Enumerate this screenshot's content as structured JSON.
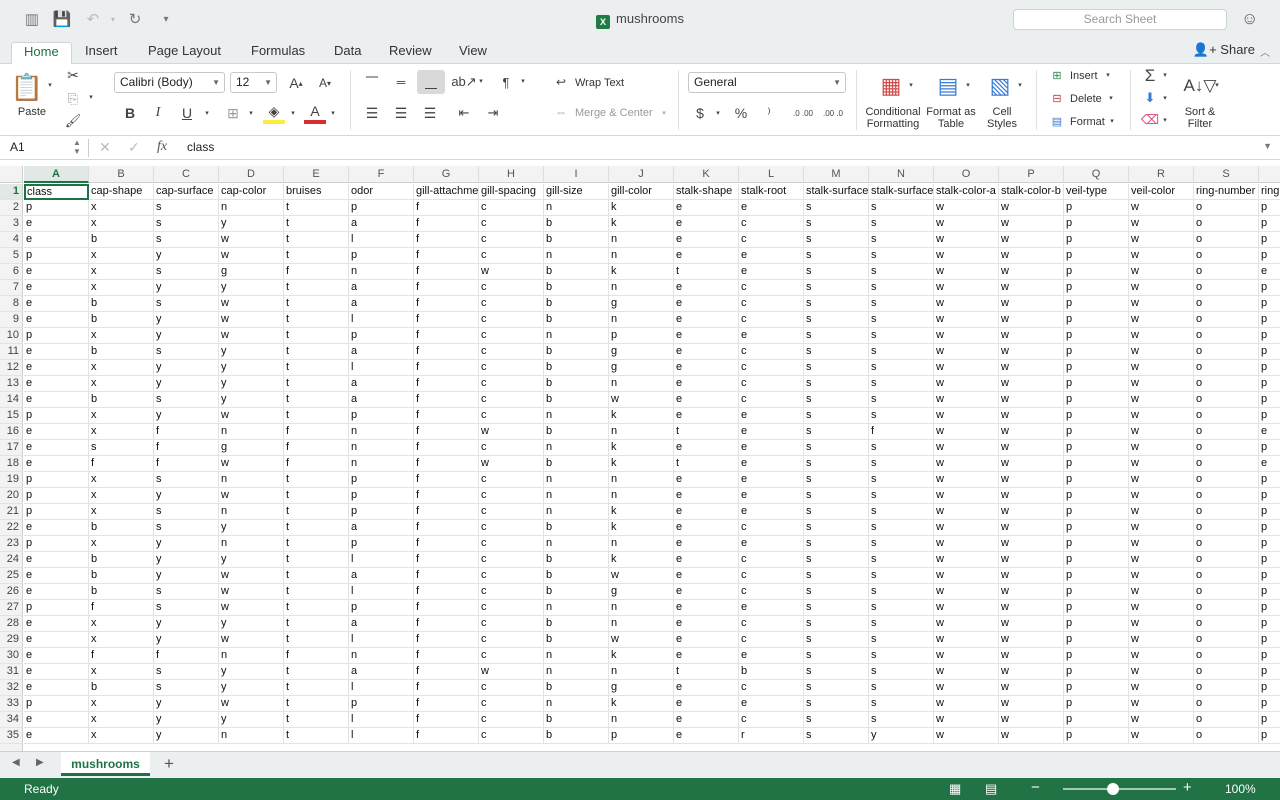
{
  "app": {
    "document_title": "mushrooms",
    "search_placeholder": "Search Sheet"
  },
  "tabs": [
    {
      "label": "Home",
      "active": true
    },
    {
      "label": "Insert"
    },
    {
      "label": "Page Layout"
    },
    {
      "label": "Formulas"
    },
    {
      "label": "Data"
    },
    {
      "label": "Review"
    },
    {
      "label": "View"
    }
  ],
  "share_label": "Share",
  "ribbon": {
    "paste_label": "Paste",
    "font_name": "Calibri (Body)",
    "font_size": "12",
    "wrap_text_label": "Wrap Text",
    "merge_center_label": "Merge & Center",
    "number_format": "General",
    "conditional_formatting_label": "Conditional Formatting",
    "format_as_table_label": "Format as Table",
    "cell_styles_label": "Cell Styles",
    "insert_label": "Insert",
    "delete_label": "Delete",
    "format_label": "Format",
    "sort_filter_label": "Sort & Filter",
    "bold_glyph": "B",
    "italic_glyph": "I",
    "underline_glyph": "U",
    "currency_glyph": "$",
    "percent_glyph": "%",
    "increase_decimal_glyph": ".0 .00",
    "decrease_decimal_glyph": ".00 .0"
  },
  "formula_bar": {
    "name_box": "A1",
    "fx": "fx",
    "content": "class"
  },
  "grid": {
    "columns": [
      "A",
      "B",
      "C",
      "D",
      "E",
      "F",
      "G",
      "H",
      "I",
      "J",
      "K",
      "L",
      "M",
      "N",
      "O",
      "P",
      "Q",
      "R",
      "S"
    ],
    "rows": [
      {
        "n": "1",
        "cells": [
          "class",
          "cap-shape",
          "cap-surface",
          "cap-color",
          "bruises",
          "odor",
          "gill-attachme",
          "gill-spacing",
          "gill-size",
          "gill-color",
          "stalk-shape",
          "stalk-root",
          "stalk-surface",
          "stalk-surface",
          "stalk-color-a",
          "stalk-color-b",
          "veil-type",
          "veil-color",
          "ring-number",
          "ring"
        ]
      },
      {
        "n": "2",
        "cells": [
          "p",
          "x",
          "s",
          "n",
          "t",
          "p",
          "f",
          "c",
          "n",
          "k",
          "e",
          "e",
          "s",
          "s",
          "w",
          "w",
          "p",
          "w",
          "o",
          "p"
        ]
      },
      {
        "n": "3",
        "cells": [
          "e",
          "x",
          "s",
          "y",
          "t",
          "a",
          "f",
          "c",
          "b",
          "k",
          "e",
          "c",
          "s",
          "s",
          "w",
          "w",
          "p",
          "w",
          "o",
          "p"
        ]
      },
      {
        "n": "4",
        "cells": [
          "e",
          "b",
          "s",
          "w",
          "t",
          "l",
          "f",
          "c",
          "b",
          "n",
          "e",
          "c",
          "s",
          "s",
          "w",
          "w",
          "p",
          "w",
          "o",
          "p"
        ]
      },
      {
        "n": "5",
        "cells": [
          "p",
          "x",
          "y",
          "w",
          "t",
          "p",
          "f",
          "c",
          "n",
          "n",
          "e",
          "e",
          "s",
          "s",
          "w",
          "w",
          "p",
          "w",
          "o",
          "p"
        ]
      },
      {
        "n": "6",
        "cells": [
          "e",
          "x",
          "s",
          "g",
          "f",
          "n",
          "f",
          "w",
          "b",
          "k",
          "t",
          "e",
          "s",
          "s",
          "w",
          "w",
          "p",
          "w",
          "o",
          "e"
        ]
      },
      {
        "n": "7",
        "cells": [
          "e",
          "x",
          "y",
          "y",
          "t",
          "a",
          "f",
          "c",
          "b",
          "n",
          "e",
          "c",
          "s",
          "s",
          "w",
          "w",
          "p",
          "w",
          "o",
          "p"
        ]
      },
      {
        "n": "8",
        "cells": [
          "e",
          "b",
          "s",
          "w",
          "t",
          "a",
          "f",
          "c",
          "b",
          "g",
          "e",
          "c",
          "s",
          "s",
          "w",
          "w",
          "p",
          "w",
          "o",
          "p"
        ]
      },
      {
        "n": "9",
        "cells": [
          "e",
          "b",
          "y",
          "w",
          "t",
          "l",
          "f",
          "c",
          "b",
          "n",
          "e",
          "c",
          "s",
          "s",
          "w",
          "w",
          "p",
          "w",
          "o",
          "p"
        ]
      },
      {
        "n": "10",
        "cells": [
          "p",
          "x",
          "y",
          "w",
          "t",
          "p",
          "f",
          "c",
          "n",
          "p",
          "e",
          "e",
          "s",
          "s",
          "w",
          "w",
          "p",
          "w",
          "o",
          "p"
        ]
      },
      {
        "n": "11",
        "cells": [
          "e",
          "b",
          "s",
          "y",
          "t",
          "a",
          "f",
          "c",
          "b",
          "g",
          "e",
          "c",
          "s",
          "s",
          "w",
          "w",
          "p",
          "w",
          "o",
          "p"
        ]
      },
      {
        "n": "12",
        "cells": [
          "e",
          "x",
          "y",
          "y",
          "t",
          "l",
          "f",
          "c",
          "b",
          "g",
          "e",
          "c",
          "s",
          "s",
          "w",
          "w",
          "p",
          "w",
          "o",
          "p"
        ]
      },
      {
        "n": "13",
        "cells": [
          "e",
          "x",
          "y",
          "y",
          "t",
          "a",
          "f",
          "c",
          "b",
          "n",
          "e",
          "c",
          "s",
          "s",
          "w",
          "w",
          "p",
          "w",
          "o",
          "p"
        ]
      },
      {
        "n": "14",
        "cells": [
          "e",
          "b",
          "s",
          "y",
          "t",
          "a",
          "f",
          "c",
          "b",
          "w",
          "e",
          "c",
          "s",
          "s",
          "w",
          "w",
          "p",
          "w",
          "o",
          "p"
        ]
      },
      {
        "n": "15",
        "cells": [
          "p",
          "x",
          "y",
          "w",
          "t",
          "p",
          "f",
          "c",
          "n",
          "k",
          "e",
          "e",
          "s",
          "s",
          "w",
          "w",
          "p",
          "w",
          "o",
          "p"
        ]
      },
      {
        "n": "16",
        "cells": [
          "e",
          "x",
          "f",
          "n",
          "f",
          "n",
          "f",
          "w",
          "b",
          "n",
          "t",
          "e",
          "s",
          "f",
          "w",
          "w",
          "p",
          "w",
          "o",
          "e"
        ]
      },
      {
        "n": "17",
        "cells": [
          "e",
          "s",
          "f",
          "g",
          "f",
          "n",
          "f",
          "c",
          "n",
          "k",
          "e",
          "e",
          "s",
          "s",
          "w",
          "w",
          "p",
          "w",
          "o",
          "p"
        ]
      },
      {
        "n": "18",
        "cells": [
          "e",
          "f",
          "f",
          "w",
          "f",
          "n",
          "f",
          "w",
          "b",
          "k",
          "t",
          "e",
          "s",
          "s",
          "w",
          "w",
          "p",
          "w",
          "o",
          "e"
        ]
      },
      {
        "n": "19",
        "cells": [
          "p",
          "x",
          "s",
          "n",
          "t",
          "p",
          "f",
          "c",
          "n",
          "n",
          "e",
          "e",
          "s",
          "s",
          "w",
          "w",
          "p",
          "w",
          "o",
          "p"
        ]
      },
      {
        "n": "20",
        "cells": [
          "p",
          "x",
          "y",
          "w",
          "t",
          "p",
          "f",
          "c",
          "n",
          "n",
          "e",
          "e",
          "s",
          "s",
          "w",
          "w",
          "p",
          "w",
          "o",
          "p"
        ]
      },
      {
        "n": "21",
        "cells": [
          "p",
          "x",
          "s",
          "n",
          "t",
          "p",
          "f",
          "c",
          "n",
          "k",
          "e",
          "e",
          "s",
          "s",
          "w",
          "w",
          "p",
          "w",
          "o",
          "p"
        ]
      },
      {
        "n": "22",
        "cells": [
          "e",
          "b",
          "s",
          "y",
          "t",
          "a",
          "f",
          "c",
          "b",
          "k",
          "e",
          "c",
          "s",
          "s",
          "w",
          "w",
          "p",
          "w",
          "o",
          "p"
        ]
      },
      {
        "n": "23",
        "cells": [
          "p",
          "x",
          "y",
          "n",
          "t",
          "p",
          "f",
          "c",
          "n",
          "n",
          "e",
          "e",
          "s",
          "s",
          "w",
          "w",
          "p",
          "w",
          "o",
          "p"
        ]
      },
      {
        "n": "24",
        "cells": [
          "e",
          "b",
          "y",
          "y",
          "t",
          "l",
          "f",
          "c",
          "b",
          "k",
          "e",
          "c",
          "s",
          "s",
          "w",
          "w",
          "p",
          "w",
          "o",
          "p"
        ]
      },
      {
        "n": "25",
        "cells": [
          "e",
          "b",
          "y",
          "w",
          "t",
          "a",
          "f",
          "c",
          "b",
          "w",
          "e",
          "c",
          "s",
          "s",
          "w",
          "w",
          "p",
          "w",
          "o",
          "p"
        ]
      },
      {
        "n": "26",
        "cells": [
          "e",
          "b",
          "s",
          "w",
          "t",
          "l",
          "f",
          "c",
          "b",
          "g",
          "e",
          "c",
          "s",
          "s",
          "w",
          "w",
          "p",
          "w",
          "o",
          "p"
        ]
      },
      {
        "n": "27",
        "cells": [
          "p",
          "f",
          "s",
          "w",
          "t",
          "p",
          "f",
          "c",
          "n",
          "n",
          "e",
          "e",
          "s",
          "s",
          "w",
          "w",
          "p",
          "w",
          "o",
          "p"
        ]
      },
      {
        "n": "28",
        "cells": [
          "e",
          "x",
          "y",
          "y",
          "t",
          "a",
          "f",
          "c",
          "b",
          "n",
          "e",
          "c",
          "s",
          "s",
          "w",
          "w",
          "p",
          "w",
          "o",
          "p"
        ]
      },
      {
        "n": "29",
        "cells": [
          "e",
          "x",
          "y",
          "w",
          "t",
          "l",
          "f",
          "c",
          "b",
          "w",
          "e",
          "c",
          "s",
          "s",
          "w",
          "w",
          "p",
          "w",
          "o",
          "p"
        ]
      },
      {
        "n": "30",
        "cells": [
          "e",
          "f",
          "f",
          "n",
          "f",
          "n",
          "f",
          "c",
          "n",
          "k",
          "e",
          "e",
          "s",
          "s",
          "w",
          "w",
          "p",
          "w",
          "o",
          "p"
        ]
      },
      {
        "n": "31",
        "cells": [
          "e",
          "x",
          "s",
          "y",
          "t",
          "a",
          "f",
          "w",
          "n",
          "n",
          "t",
          "b",
          "s",
          "s",
          "w",
          "w",
          "p",
          "w",
          "o",
          "p"
        ]
      },
      {
        "n": "32",
        "cells": [
          "e",
          "b",
          "s",
          "y",
          "t",
          "l",
          "f",
          "c",
          "b",
          "g",
          "e",
          "c",
          "s",
          "s",
          "w",
          "w",
          "p",
          "w",
          "o",
          "p"
        ]
      },
      {
        "n": "33",
        "cells": [
          "p",
          "x",
          "y",
          "w",
          "t",
          "p",
          "f",
          "c",
          "n",
          "k",
          "e",
          "e",
          "s",
          "s",
          "w",
          "w",
          "p",
          "w",
          "o",
          "p"
        ]
      },
      {
        "n": "34",
        "cells": [
          "e",
          "x",
          "y",
          "y",
          "t",
          "l",
          "f",
          "c",
          "b",
          "n",
          "e",
          "c",
          "s",
          "s",
          "w",
          "w",
          "p",
          "w",
          "o",
          "p"
        ]
      },
      {
        "n": "35",
        "cells": [
          "e",
          "x",
          "y",
          "n",
          "t",
          "l",
          "f",
          "c",
          "b",
          "p",
          "e",
          "r",
          "s",
          "y",
          "w",
          "w",
          "p",
          "w",
          "o",
          "p"
        ]
      }
    ]
  },
  "sheet_tabs": [
    "mushrooms"
  ],
  "add_sheet": "+",
  "status": {
    "text": "Ready",
    "zoom": "100%",
    "zoom_minus": "−",
    "zoom_plus": "+"
  },
  "colors": {
    "accent": "#1e7345",
    "status_bar": "#217346"
  }
}
